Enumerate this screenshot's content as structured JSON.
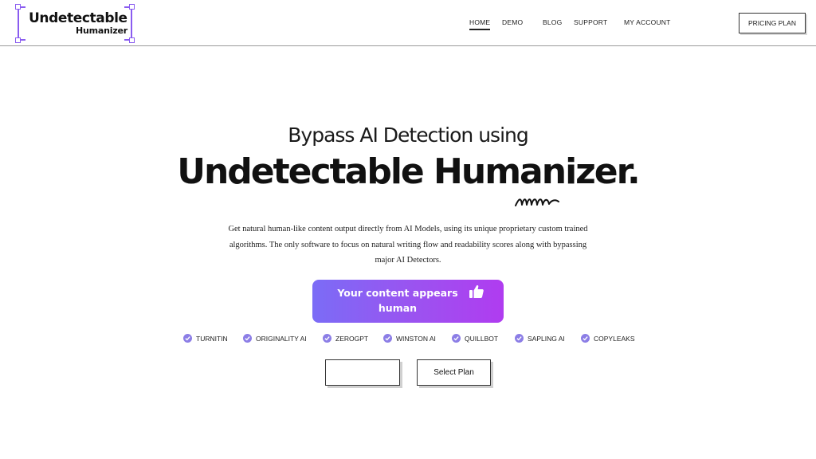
{
  "logo": {
    "line1": "Undetectable",
    "line2": "Humanizer"
  },
  "nav": {
    "items": [
      {
        "label": "HOME",
        "active": true
      },
      {
        "label": "DEMO",
        "active": false
      },
      {
        "label": "BLOG",
        "active": false
      },
      {
        "label": "SUPPORT",
        "active": false
      },
      {
        "label": "MY ACCOUNT",
        "active": false
      }
    ],
    "pricing_label": "PRICING PLAN"
  },
  "hero": {
    "subtitle": "Bypass AI Detection using",
    "title": "Undetectable Humanizer.",
    "description_lines": [
      "Get natural human-like content output directly from AI Models, using its unique proprietary custom trained",
      "algorithms. The only software to focus on natural writing flow and readability scores along with bypassing",
      "major AI Detectors."
    ],
    "cta": {
      "line1": "Your content appears",
      "line2": "human",
      "icon": "thumbs-up-icon"
    },
    "detectors": [
      "TURNITIN",
      "ORIGINALITY AI",
      "ZEROGPT",
      "WINSTON AI",
      "QUILLBOT",
      "SAPLING AI",
      "COPYLEAKS"
    ],
    "buttons": {
      "empty_label": "",
      "select_label": "Select Plan"
    }
  },
  "colors": {
    "accent_start": "#7b6cf6",
    "accent_end": "#b03cf0",
    "check": "#8c7ee6",
    "logo_frame": "#8a5cf0"
  }
}
